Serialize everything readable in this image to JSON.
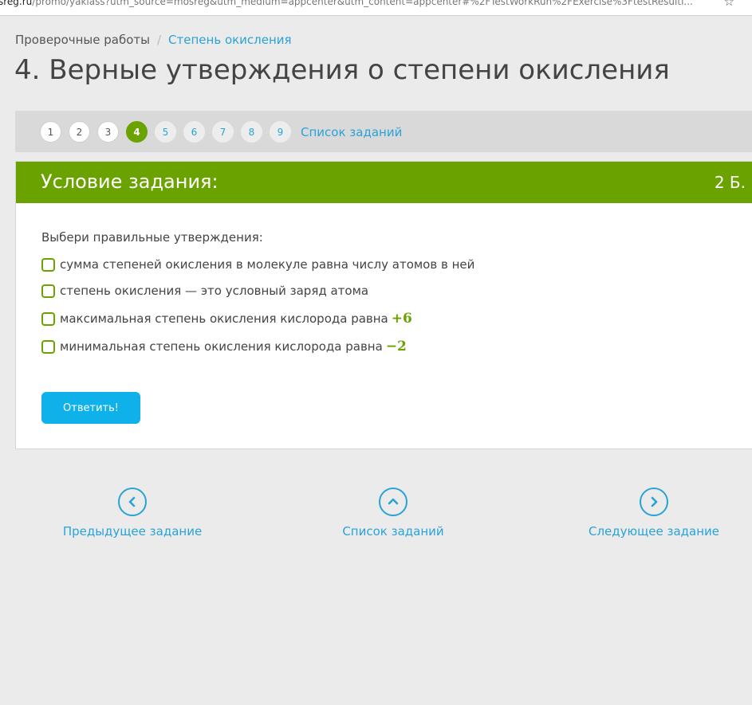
{
  "browser": {
    "url_domain": "sreg.ru",
    "url_rest": "/promo/yaklass?utm_source=mosreg&utm_medium=appcenter&utm_content=appcenter#%2FTestWorkRun%2FExercise%3FtestResulti..."
  },
  "breadcrumb": {
    "parent": "Проверочные работы",
    "separator": "/",
    "current": "Степень окисления"
  },
  "page_title": "4. Верные утверждения о степени окисления",
  "pager": {
    "numbers": [
      "1",
      "2",
      "3",
      "4",
      "5",
      "6",
      "7",
      "8",
      "9"
    ],
    "current": "4",
    "list_link": "Список заданий"
  },
  "task": {
    "header": "Условие задания:",
    "points": "2 Б.",
    "question": "Выбери правильные утверждения:",
    "options": [
      {
        "text": "сумма степеней окисления в молекуле равна числу атомов в ней",
        "math": ""
      },
      {
        "text": "степень окисления — это условный заряд атома",
        "math": ""
      },
      {
        "text": "максимальная степень окисления кислорода равна",
        "math": "+6"
      },
      {
        "text": "минимальная степень окисления кислорода равна",
        "math": "−2"
      }
    ],
    "submit_label": "Ответить!"
  },
  "navigation": {
    "prev_label": "Предыдущее задание",
    "list_label": "Список заданий",
    "next_label": "Следующее задание"
  },
  "colors": {
    "accent_green": "#6aa200",
    "link_blue": "#29a3d6",
    "button_blue": "#0fb1ea"
  }
}
